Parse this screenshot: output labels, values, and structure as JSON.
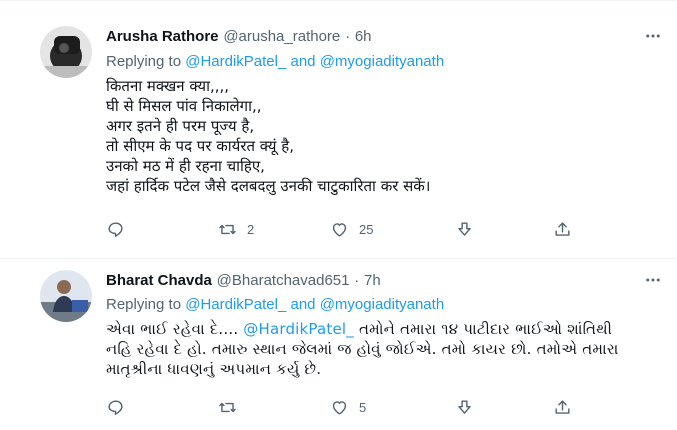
{
  "tweets": [
    {
      "name": "Arusha Rathore",
      "handle": "@arusha_rathore",
      "sep": "·",
      "time": "6h",
      "replying_prefix": "Replying to",
      "replying_to_1": "@HardikPatel_",
      "replying_and": "and",
      "replying_to_2": "@myogiadityanath",
      "lines": [
        "कितना मक्खन क्या,,,,",
        "घी से मिसल पांव निकालेगा,,",
        "अगर इतने ही परम पूज्य है,",
        "तो सीएम के पद पर कार्यरत क्यूं है,",
        "उनको मठ में ही रहना चाहिए,",
        "जहां हार्दिक पटेल जैसे दलबदलु उनकी चाटुकारिता कर सकें।"
      ],
      "reply_count": "",
      "retweet_count": "2",
      "like_count": "25"
    },
    {
      "name": "Bharat Chavda",
      "handle": "@Bharatchavad651",
      "sep": "·",
      "time": "7h",
      "replying_prefix": "Replying to",
      "replying_to_1": "@HardikPatel_",
      "replying_and": "and",
      "replying_to_2": "@myogiadityanath",
      "line1_pre": "એવા ભાઈ રહેવા દે.... ",
      "line1_mention": "@HardikPatel_",
      "line1_post": "  તમોને તમારા ૧૪ પાટીદાર ભાઈઓ શાંતિથી",
      "line2": "નહિ રહેવા દે હો. તમારુ સ્થાન જેલમાં જ હોવું જોઈએ. તમો કાયર છો. તમોએ તમારા",
      "line3": "માતૃશ્રીના ધાવણનું અપમાન કર્યુ છે.",
      "reply_count": "",
      "retweet_count": "",
      "like_count": "5"
    }
  ],
  "icons": {
    "more": "more-horizontal-icon",
    "reply": "reply-icon",
    "retweet": "retweet-icon",
    "like": "like-icon",
    "downvote": "downvote-icon",
    "share": "share-icon"
  },
  "colors": {
    "accent": "#1d9bf0",
    "text": "#0f1419",
    "muted": "#536471",
    "divider": "#eff3f4"
  }
}
